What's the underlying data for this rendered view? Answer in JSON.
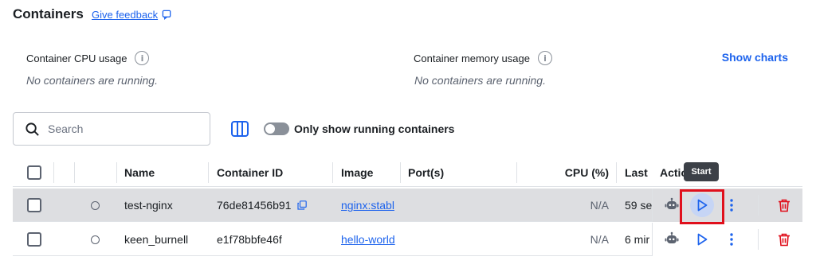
{
  "header": {
    "title": "Containers",
    "feedback_label": "Give feedback"
  },
  "stats": {
    "cpu_label": "Container CPU usage",
    "cpu_empty": "No containers are running.",
    "memory_label": "Container memory usage",
    "memory_empty": "No containers are running.",
    "show_charts_label": "Show charts"
  },
  "toolbar": {
    "search_placeholder": "Search",
    "search_value": "",
    "running_toggle_label": "Only show running containers",
    "running_toggle_on": false
  },
  "table": {
    "columns": {
      "name": "Name",
      "container_id": "Container ID",
      "image": "Image",
      "ports": "Port(s)",
      "cpu": "CPU (%)",
      "last": "Last",
      "actions": "Actio"
    },
    "rows": [
      {
        "name": "test-nginx",
        "container_id": "76de81456b91",
        "image": "nginx:stabl",
        "ports": "",
        "cpu": "N/A",
        "last": "59 se"
      },
      {
        "name": "keen_burnell",
        "container_id": "e1f78bbfe46f",
        "image": "hello-world",
        "ports": "",
        "cpu": "N/A",
        "last": "6 mir"
      }
    ]
  },
  "tooltip": {
    "text": "Start"
  },
  "colors": {
    "accent": "#1d63ed",
    "danger": "#e0101c",
    "row_hover": "#dddee1"
  },
  "icons": {
    "feedback": "feedback-icon",
    "info": "info-icon",
    "search": "search-icon",
    "columns": "columns-icon",
    "copy": "copy-icon",
    "debug": "bot-icon",
    "start": "play-icon",
    "more": "kebab-menu-icon",
    "delete": "trash-icon"
  }
}
